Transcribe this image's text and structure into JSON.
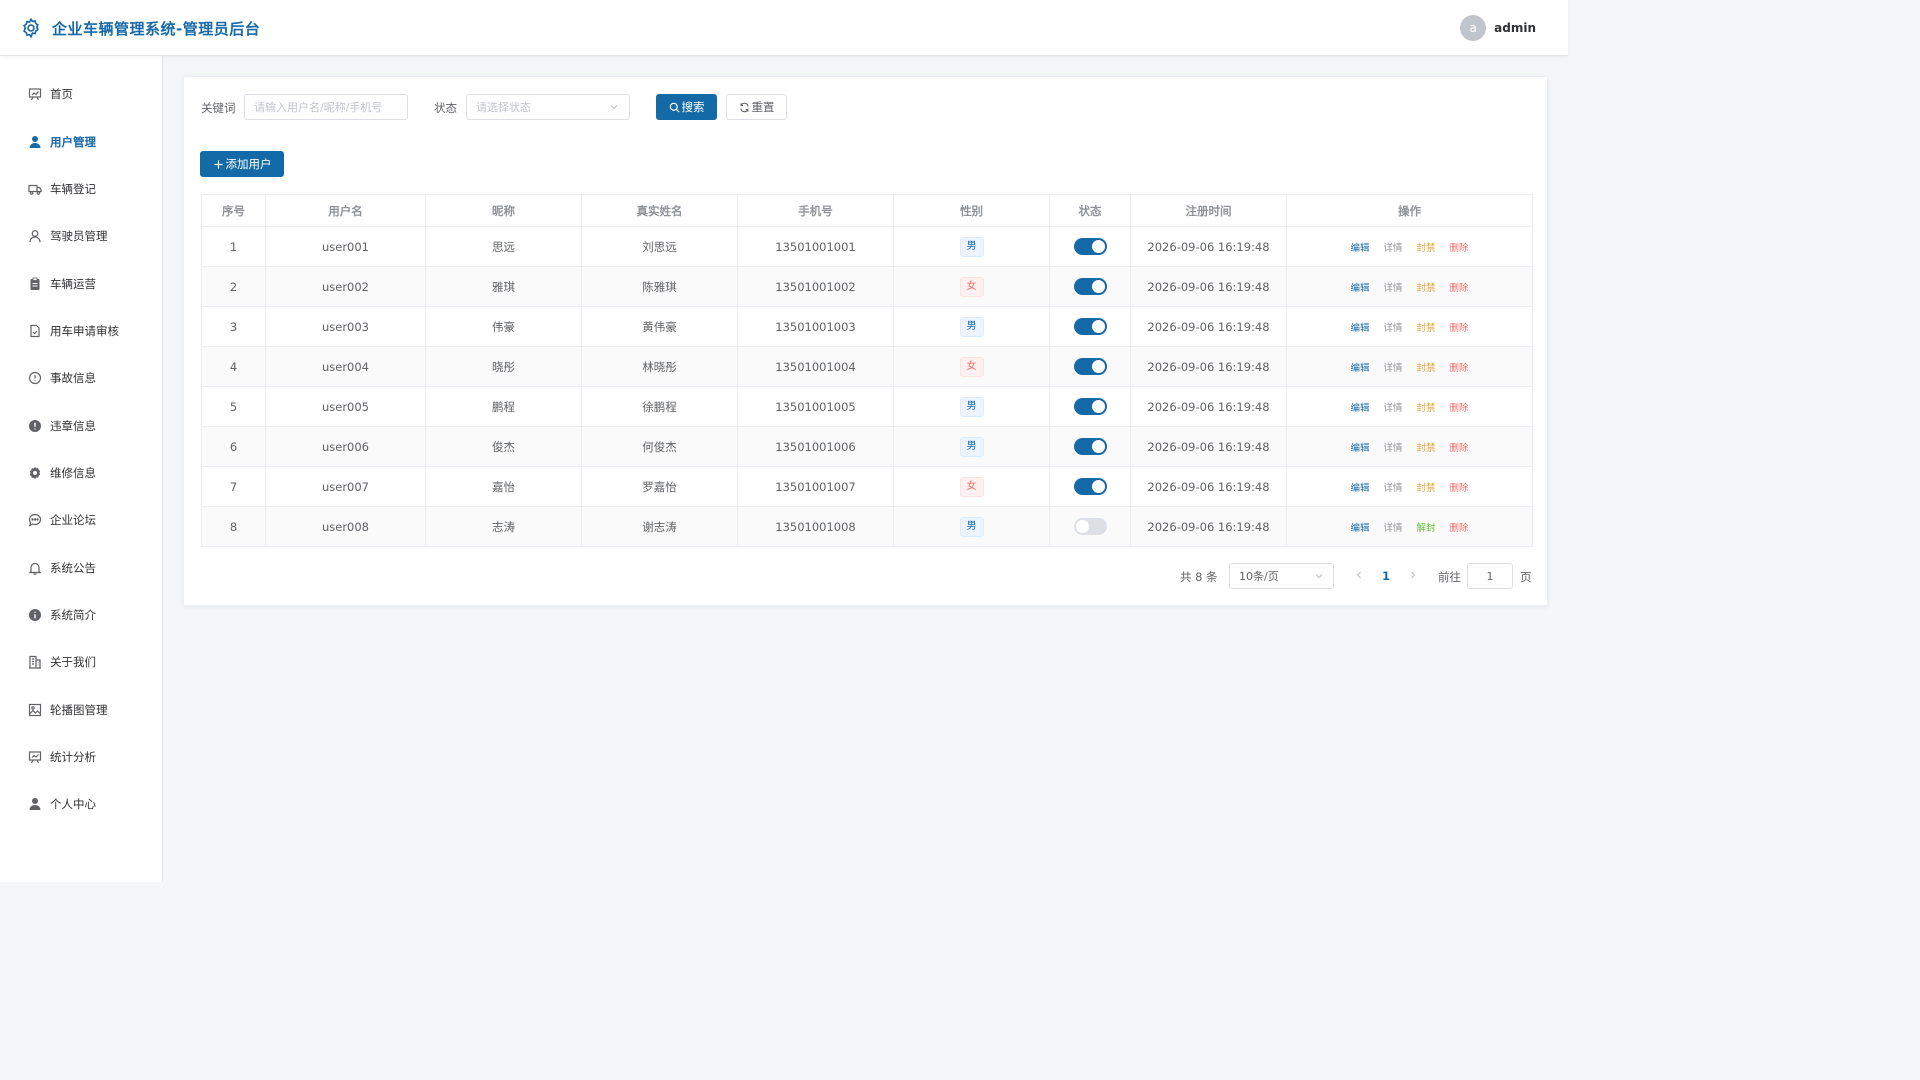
{
  "header": {
    "title": "企业车辆管理系统-管理员后台",
    "avatar_letter": "a",
    "username": "admin"
  },
  "sidebar": {
    "items": [
      {
        "label": "首页",
        "icon": "chart-board-icon",
        "active": false
      },
      {
        "label": "用户管理",
        "icon": "user-icon",
        "active": true
      },
      {
        "label": "车辆登记",
        "icon": "truck-icon",
        "active": false
      },
      {
        "label": "驾驶员管理",
        "icon": "person-icon",
        "active": false
      },
      {
        "label": "车辆运营",
        "icon": "clipboard-icon",
        "active": false
      },
      {
        "label": "用车申请审核",
        "icon": "document-check-icon",
        "active": false
      },
      {
        "label": "事故信息",
        "icon": "warning-circle-icon",
        "active": false
      },
      {
        "label": "违章信息",
        "icon": "warning-filled-icon",
        "active": false
      },
      {
        "label": "维修信息",
        "icon": "gear-icon",
        "active": false
      },
      {
        "label": "企业论坛",
        "icon": "chat-bubble-icon",
        "active": false
      },
      {
        "label": "系统公告",
        "icon": "bell-icon",
        "active": false
      },
      {
        "label": "系统简介",
        "icon": "info-filled-icon",
        "active": false
      },
      {
        "label": "关于我们",
        "icon": "office-building-icon",
        "active": false
      },
      {
        "label": "轮播图管理",
        "icon": "picture-icon",
        "active": false
      },
      {
        "label": "统计分析",
        "icon": "presentation-chart-icon",
        "active": false
      },
      {
        "label": "个人中心",
        "icon": "user-filled-icon",
        "active": false
      }
    ]
  },
  "filters": {
    "keyword_label": "关键词",
    "keyword_placeholder": "请输入用户名/昵称/手机号",
    "status_label": "状态",
    "status_placeholder": "请选择状态",
    "search_label": "搜索",
    "reset_label": "重置"
  },
  "add_button_label": "添加用户",
  "table": {
    "columns": [
      "序号",
      "用户名",
      "昵称",
      "真实姓名",
      "手机号",
      "性别",
      "状态",
      "注册时间",
      "操作"
    ],
    "rows": [
      {
        "index": "1",
        "username": "user001",
        "nickname": "思远",
        "realname": "刘思远",
        "phone": "13501001001",
        "gender": "男",
        "enabled": true,
        "registered": "2026-09-06 16:19:48",
        "toggle_label": "封禁"
      },
      {
        "index": "2",
        "username": "user002",
        "nickname": "雅琪",
        "realname": "陈雅琪",
        "phone": "13501001002",
        "gender": "女",
        "enabled": true,
        "registered": "2026-09-06 16:19:48",
        "toggle_label": "封禁"
      },
      {
        "index": "3",
        "username": "user003",
        "nickname": "伟豪",
        "realname": "黄伟豪",
        "phone": "13501001003",
        "gender": "男",
        "enabled": true,
        "registered": "2026-09-06 16:19:48",
        "toggle_label": "封禁"
      },
      {
        "index": "4",
        "username": "user004",
        "nickname": "晓彤",
        "realname": "林晓彤",
        "phone": "13501001004",
        "gender": "女",
        "enabled": true,
        "registered": "2026-09-06 16:19:48",
        "toggle_label": "封禁"
      },
      {
        "index": "5",
        "username": "user005",
        "nickname": "鹏程",
        "realname": "徐鹏程",
        "phone": "13501001005",
        "gender": "男",
        "enabled": true,
        "registered": "2026-09-06 16:19:48",
        "toggle_label": "封禁"
      },
      {
        "index": "6",
        "username": "user006",
        "nickname": "俊杰",
        "realname": "何俊杰",
        "phone": "13501001006",
        "gender": "男",
        "enabled": true,
        "registered": "2026-09-06 16:19:48",
        "toggle_label": "封禁"
      },
      {
        "index": "7",
        "username": "user007",
        "nickname": "嘉怡",
        "realname": "罗嘉怡",
        "phone": "13501001007",
        "gender": "女",
        "enabled": true,
        "registered": "2026-09-06 16:19:48",
        "toggle_label": "封禁"
      },
      {
        "index": "8",
        "username": "user008",
        "nickname": "志涛",
        "realname": "谢志涛",
        "phone": "13501001008",
        "gender": "男",
        "enabled": false,
        "registered": "2026-09-06 16:19:48",
        "toggle_label": "解封"
      }
    ],
    "actions": {
      "edit": "编辑",
      "detail": "详情",
      "delete": "删除"
    }
  },
  "pagination": {
    "total_text": "共 8 条",
    "page_size": "10条/页",
    "current_page": "1",
    "goto_label": "前往",
    "goto_value": "1",
    "page_unit": "页"
  },
  "colors": {
    "primary": "#136aa6",
    "title": "#1769a8",
    "ban": "#e6a23c",
    "unban": "#67c23a",
    "delete": "#f56c6c"
  }
}
